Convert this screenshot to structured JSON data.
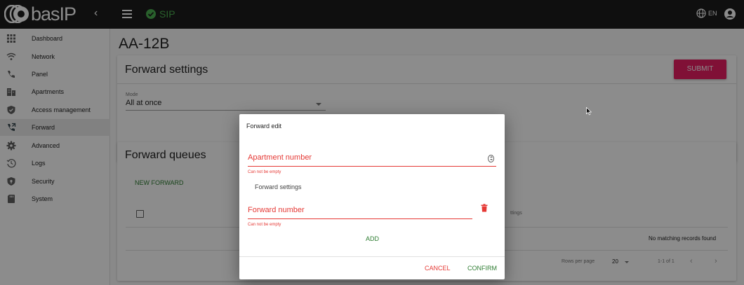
{
  "header": {
    "logo_text": "basIP",
    "collapse_glyph": "‹",
    "sip_label": "SIP",
    "language": "EN"
  },
  "sidebar": {
    "items": [
      {
        "label": "Dashboard",
        "icon": "grid-icon"
      },
      {
        "label": "Network",
        "icon": "wifi-icon"
      },
      {
        "label": "Panel",
        "icon": "phone-icon"
      },
      {
        "label": "Apartments",
        "icon": "building-icon"
      },
      {
        "label": "Access management",
        "icon": "shield-check-icon"
      },
      {
        "label": "Forward",
        "icon": "phone-forward-icon",
        "active": true
      },
      {
        "label": "Advanced",
        "icon": "gear-icon"
      },
      {
        "label": "Logs",
        "icon": "history-icon"
      },
      {
        "label": "Security",
        "icon": "shield-lock-icon"
      },
      {
        "label": "System",
        "icon": "sd-card-icon"
      }
    ]
  },
  "main": {
    "page_title": "AA-12B",
    "forward_settings": {
      "title": "Forward settings",
      "submit_label": "SUBMIT",
      "mode_label": "Mode",
      "mode_value": "All at once"
    },
    "forward_queues": {
      "title": "Forward queues",
      "new_forward_label": "NEW FORWARD",
      "column_partial": "ttings",
      "empty_text": "No matching records found",
      "rows_per_page_label": "Rows per page",
      "rows_per_page_value": "20",
      "range_text": "1-1 of 1",
      "prev_glyph": "‹",
      "next_glyph": "›"
    }
  },
  "dialog": {
    "title": "Forward edit",
    "apartment_placeholder": "Apartment number",
    "apartment_error": "Can not be empty",
    "forward_settings_label": "Forward settings",
    "forward_number_placeholder": "Forward number",
    "forward_number_error": "Can not be empty",
    "add_label": "ADD",
    "cancel_label": "CANCEL",
    "confirm_label": "CONFIRM"
  },
  "colors": {
    "topbar": "#1d1d1d",
    "accent_pink": "#e91e63",
    "success_green": "#4caf50",
    "action_green": "#2e7d32",
    "error_red": "#e53935"
  }
}
